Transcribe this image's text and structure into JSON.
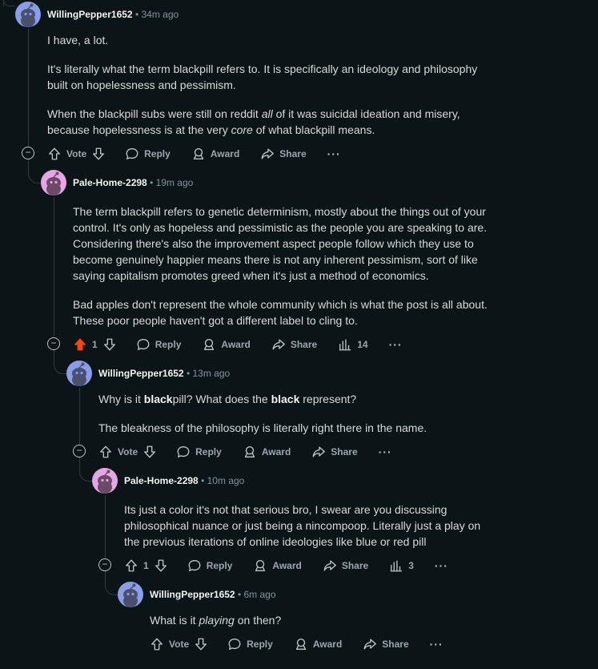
{
  "colors": {
    "background": "#0b1416",
    "thread_line": "#343a40",
    "upvote_active": "#ff4500",
    "avatar_blue": "#8a9de8",
    "avatar_pink": "#e6a6e6"
  },
  "labels": {
    "vote": "Vote",
    "reply": "Reply",
    "award": "Award",
    "share": "Share",
    "more": "···",
    "collapse": "−",
    "separator": "•"
  },
  "comments": [
    {
      "author": "WillingPepper1652",
      "time": "34m ago",
      "avatar": "blue",
      "paragraphs": [
        "I have, a lot.",
        "It's literally what the term blackpill refers to. It is specifically an ideology and philosophy built on hopelessness and pessimism.",
        "When the blackpill subs were still on reddit all of it was suicidal ideation and misery, because hopelessness is at the very core of what blackpill means."
      ],
      "vote_label": "Vote"
    },
    {
      "author": "Pale-Home-2298",
      "time": "19m ago",
      "avatar": "pink",
      "paragraphs": [
        "The term blackpill refers to genetic determinism, mostly about the things out of your control. It's only as hopeless and pessimistic as the people you are speaking to are. Considering there's also the improvement aspect people follow which they use to become genuinely happier means there is not any inherent pessimism, sort of like saying capitalism promotes greed when it's just a method of economics.",
        "Bad apples don't represent the whole community which is what the post is all about. These poor people haven't got a different label to cling to."
      ],
      "vote_label": "1",
      "upvoted": true,
      "insights": "14"
    },
    {
      "author": "WillingPepper1652",
      "time": "13m ago",
      "avatar": "blue",
      "paragraphs": [
        "Why is it blackpill? What does the black represent?",
        "The bleakness of the philosophy is literally right there in the name."
      ],
      "vote_label": "Vote"
    },
    {
      "author": "Pale-Home-2298",
      "time": "10m ago",
      "avatar": "pink",
      "paragraphs": [
        "Its just a color it's not that serious bro, I swear are you discussing philosophical nuance or just being a nincompoop. Literally just a play on the previous iterations of online ideologies like blue or red pill"
      ],
      "vote_label": "1",
      "insights": "3"
    },
    {
      "author": "WillingPepper1652",
      "time": "6m ago",
      "avatar": "blue",
      "paragraphs": [
        "What is it playing on then?"
      ],
      "vote_label": "Vote"
    }
  ]
}
